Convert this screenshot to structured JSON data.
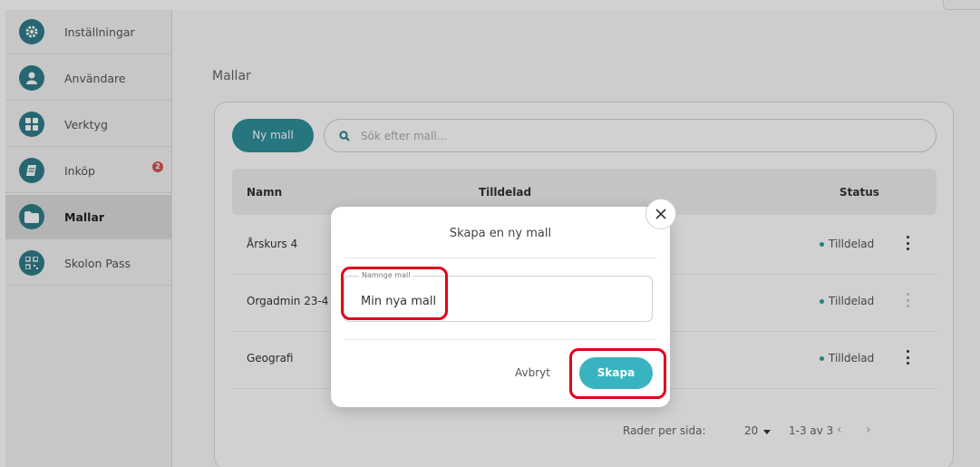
{
  "sidebar": {
    "items": [
      {
        "label": "Inställningar",
        "icon": "gear-icon"
      },
      {
        "label": "Användare",
        "icon": "user-icon"
      },
      {
        "label": "Verktyg",
        "icon": "grid-icon"
      },
      {
        "label": "Inköp",
        "icon": "book-icon",
        "badge": "2"
      },
      {
        "label": "Mallar",
        "icon": "folder-icon",
        "active": true
      },
      {
        "label": "Skolon Pass",
        "icon": "qr-icon"
      }
    ]
  },
  "main": {
    "title": "Mallar",
    "new_button": "Ny mall",
    "search_placeholder": "Sök efter mall...",
    "columns": {
      "name": "Namn",
      "assigned": "Tilldelad",
      "status": "Status"
    },
    "rows": [
      {
        "name": "Årskurs 4",
        "status": "Tilldelad"
      },
      {
        "name": "Orgadmin 23-4",
        "status": "Tilldelad"
      },
      {
        "name": "Geografi",
        "status": "Tilldelad"
      }
    ],
    "pager": {
      "rows_label": "Rader per sida:",
      "rows_value": "20",
      "range": "1-3 av 3",
      "prev": "‹",
      "next": "›"
    }
  },
  "dialog": {
    "title": "Skapa en ny mall",
    "field_label": "Namnge mall",
    "field_value": "Min nya mall",
    "cancel": "Avbryt",
    "create": "Skapa",
    "close": "×"
  },
  "colors": {
    "accent": "#2f8f9c",
    "create_button": "#38b3bf",
    "annotation": "#e2001a",
    "status_dot": "#2aa198"
  }
}
